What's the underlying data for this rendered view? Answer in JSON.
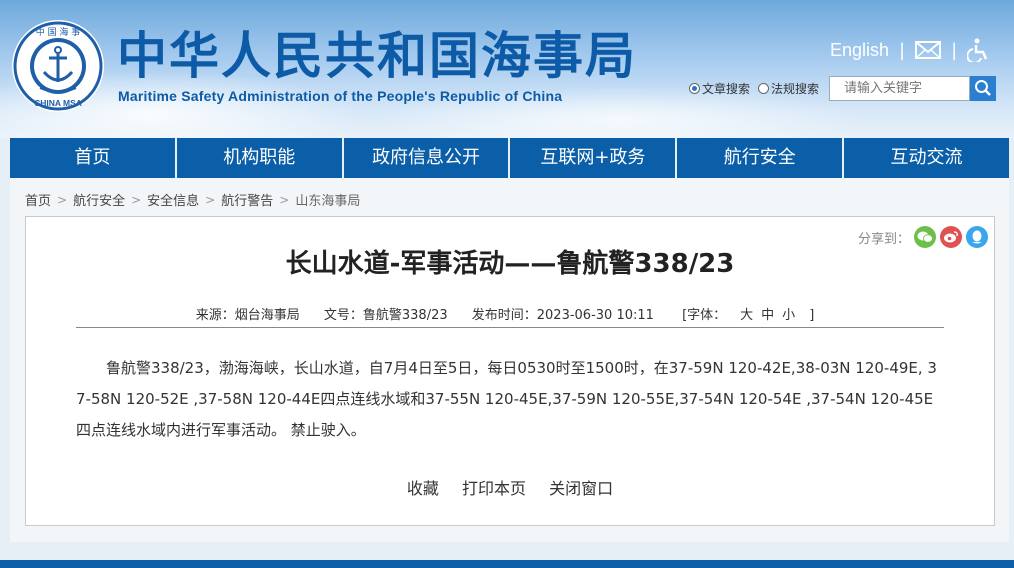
{
  "header": {
    "title_cn": "中华人民共和国海事局",
    "title_en": "Maritime Safety Administration of the People's Republic of China",
    "logo_top_text": "中 国 海 事",
    "logo_bottom_text": "CHINA MSA",
    "english_link": "English",
    "search": {
      "option_article": "文章搜索",
      "option_law": "法规搜索",
      "placeholder": "请输入关键字"
    }
  },
  "nav": [
    {
      "label": "首页"
    },
    {
      "label": "机构职能"
    },
    {
      "label": "政府信息公开"
    },
    {
      "label": "互联网+政务"
    },
    {
      "label": "航行安全"
    },
    {
      "label": "互动交流"
    }
  ],
  "breadcrumb": [
    "首页",
    "航行安全",
    "安全信息",
    "航行警告",
    "山东海事局"
  ],
  "article": {
    "share_label": "分享到：",
    "title": "长山水道-军事活动——鲁航警338/23",
    "source": "来源：烟台海事局",
    "doc_no": "文号：鲁航警338/23",
    "publish_time": "发布时间：2023-06-30 10:11",
    "font_label": "[字体：",
    "font_large": "大",
    "font_medium": "中",
    "font_small": "小",
    "font_close": "]",
    "body": "鲁航警338/23，渤海海峡，长山水道，自7月4日至5日，每日0530时至1500时，在37-59N 120-42E,38-03N 120-49E, 37-58N 120-52E ,37-58N 120-44E四点连线水域和37-55N 120-45E,37-59N 120-55E,37-54N 120-54E ,37-54N 120-45E四点连线水域内进行军事活动。 禁止驶入。",
    "actions": {
      "favorite": "收藏",
      "print": "打印本页",
      "close": "关闭窗口"
    }
  },
  "colors": {
    "brand_blue": "#0b5fa8",
    "title_blue": "#0d5aa7",
    "wechat_green": "#6cc04a",
    "weibo_red": "#e05252",
    "qq_blue": "#3aa6ef"
  }
}
